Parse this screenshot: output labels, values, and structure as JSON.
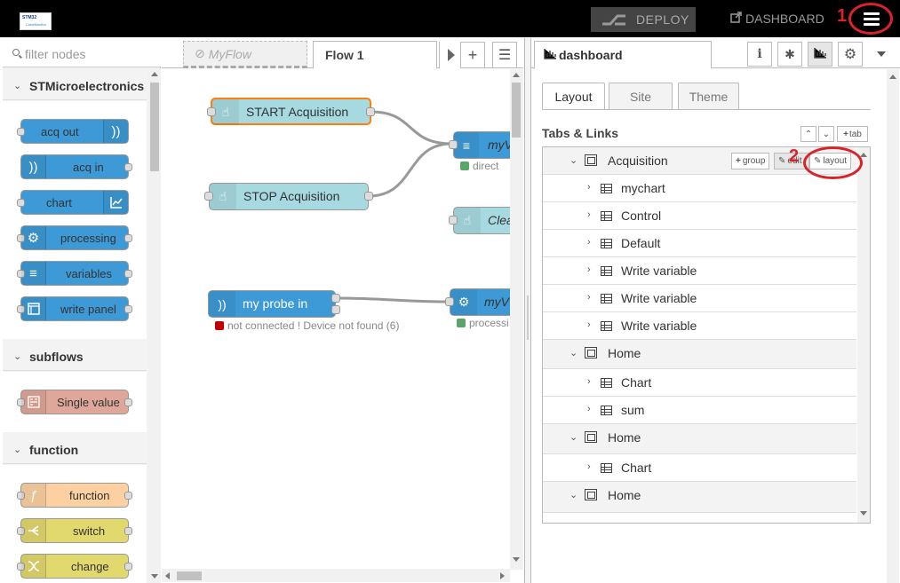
{
  "header": {
    "logo_line1": "STM32",
    "logo_line2": "CubeMonitor",
    "deploy_label": "DEPLOY",
    "dashboard_link": "DASHBOARD",
    "annotation_1": "1",
    "annotation_2": "2"
  },
  "palette": {
    "search_placeholder": "filter nodes",
    "categories": [
      {
        "label": "STMicroelectronics",
        "nodes": [
          {
            "label": "acq out",
            "color": "#3d9ad6",
            "icon": "wave-icon"
          },
          {
            "label": "acq in",
            "color": "#3d9ad6",
            "icon": "wave-icon"
          },
          {
            "label": "chart",
            "color": "#3d9ad6",
            "icon": "chart-icon"
          },
          {
            "label": "processing",
            "color": "#3d9ad6",
            "icon": "gear-icon"
          },
          {
            "label": "variables",
            "color": "#3d9ad6",
            "icon": "list-icon"
          },
          {
            "label": "write panel",
            "color": "#3d9ad6",
            "icon": "panel-icon"
          }
        ]
      },
      {
        "label": "subflows",
        "nodes": [
          {
            "label": "Single value",
            "color": "#dfa799",
            "icon": "subflow-icon"
          }
        ]
      },
      {
        "label": "function",
        "nodes": [
          {
            "label": "function",
            "color": "#fdd0a2",
            "icon": "function-icon"
          },
          {
            "label": "switch",
            "color": "#e2d96e",
            "icon": "switch-icon"
          },
          {
            "label": "change",
            "color": "#e2d96e",
            "icon": "change-icon"
          }
        ]
      }
    ]
  },
  "workspace": {
    "tabs": [
      {
        "label": "MyFlow",
        "disabled": true
      },
      {
        "label": "Flow 1",
        "disabled": false
      }
    ],
    "nodes": {
      "start": "START Acquisition",
      "stop": "STOP Acquisition",
      "myv1": "myV",
      "myv1_status": "direct",
      "clear": "Clea",
      "probe": "my probe in",
      "probe_status": "not connected ! Device not found (6)",
      "myv2": "myV",
      "myv2_status": "processi"
    },
    "colors": {
      "inject": "#a6d9e0",
      "stm": "#3d9ad6",
      "status_red": "#c00000",
      "status_green": "#5aa66a"
    }
  },
  "sidebar": {
    "tab_label": "dashboard",
    "subtabs": [
      "Layout",
      "Site",
      "Theme"
    ],
    "section_title": "Tabs & Links",
    "tab_button": "tab",
    "group_button": "group",
    "edit_button": "edit",
    "layout_button": "layout",
    "tree": [
      {
        "type": "tab",
        "label": "Acquisition"
      },
      {
        "type": "group",
        "label": "mychart"
      },
      {
        "type": "group",
        "label": "Control"
      },
      {
        "type": "group",
        "label": "Default"
      },
      {
        "type": "group",
        "label": "Write variable"
      },
      {
        "type": "group",
        "label": "Write variable"
      },
      {
        "type": "group",
        "label": "Write variable"
      },
      {
        "type": "tab",
        "label": "Home"
      },
      {
        "type": "group",
        "label": "Chart"
      },
      {
        "type": "group",
        "label": "sum"
      },
      {
        "type": "tab",
        "label": "Home"
      },
      {
        "type": "group",
        "label": "Chart"
      },
      {
        "type": "tab",
        "label": "Home"
      }
    ]
  }
}
